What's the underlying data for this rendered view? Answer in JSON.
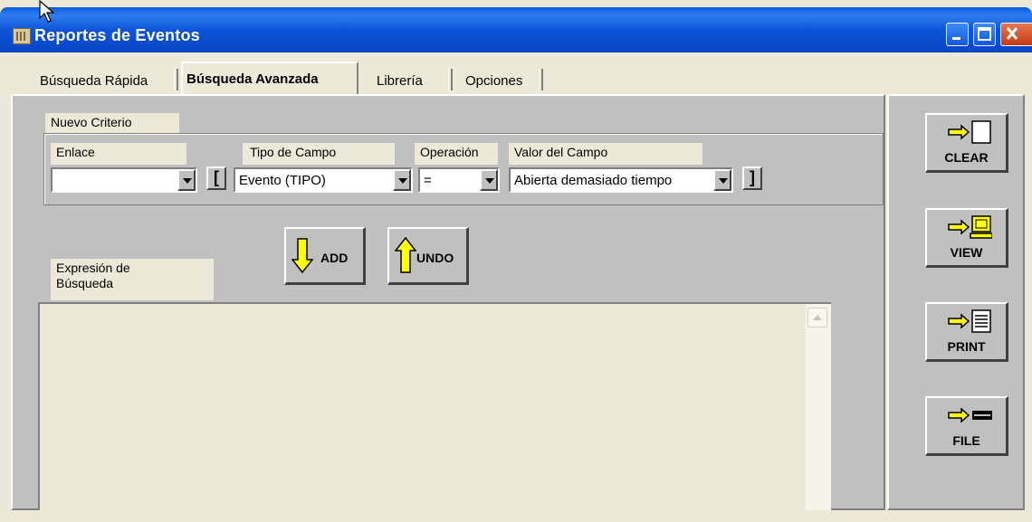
{
  "window": {
    "title": "Reportes de Eventos",
    "controls": [
      "minimize-icon",
      "maximize-icon",
      "close-icon"
    ]
  },
  "tabs": [
    {
      "label": "Búsqueda Rápida",
      "active": false
    },
    {
      "label": "Búsqueda Avanzada",
      "active": true
    },
    {
      "label": "Librería",
      "active": false
    },
    {
      "label": "Opciones",
      "active": false
    }
  ],
  "criteria": {
    "group_label": "Nuevo Criterio",
    "enlace_label": "Enlace",
    "enlace_value": "",
    "open_paren": "[",
    "tipo_label": "Tipo de Campo",
    "tipo_value": "Evento (TIPO)",
    "operacion_label": "Operación",
    "operacion_value": "=",
    "valor_label": "Valor del Campo",
    "valor_value": "Abierta demasiado tiempo",
    "close_paren": "]"
  },
  "actions": {
    "add_label": "ADD",
    "undo_label": "UNDO"
  },
  "expression": {
    "label_line1": "Expresión de",
    "label_line2": "Búsqueda",
    "value": ""
  },
  "side_buttons": [
    {
      "label": "CLEAR",
      "icon": "clear-icon"
    },
    {
      "label": "VIEW",
      "icon": "view-screen-icon"
    },
    {
      "label": "PRINT",
      "icon": "print-document-icon"
    },
    {
      "label": "FILE",
      "icon": "file-disk-icon"
    }
  ],
  "colors": {
    "titlebar": "#0a5ce2",
    "panel": "#c0c0c0",
    "arrow_yellow": "#ffff00"
  }
}
